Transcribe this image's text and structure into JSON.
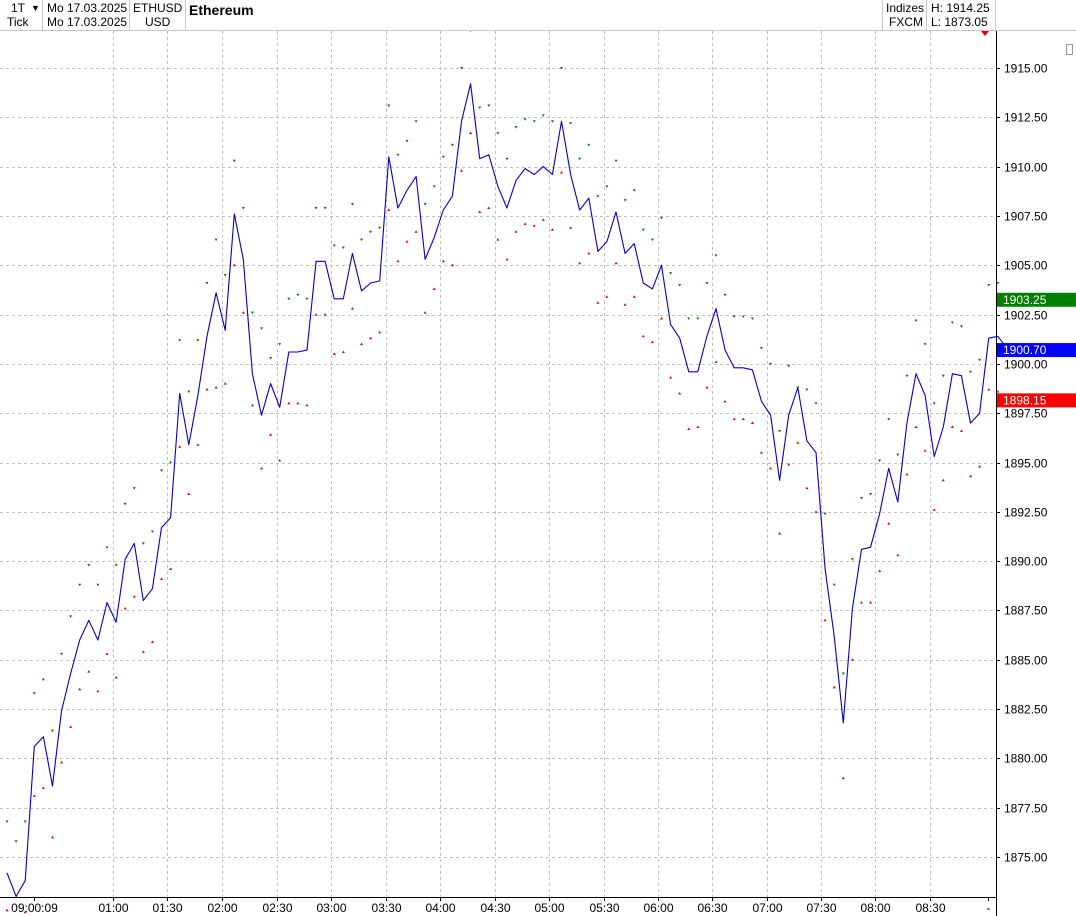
{
  "header": {
    "interval": "1T",
    "interval_sub": "Tick",
    "date_from": "Mo 17.03.2025",
    "date_to": "Mo 17.03.2025",
    "symbol": "ETHUSD",
    "currency": "USD",
    "instrument": "Ethereum",
    "category": "Indizes",
    "source": "FXCM",
    "high": "H: 1914.25",
    "low": "L: 1873.05"
  },
  "colors": {
    "line": "#0000cc",
    "upper_band": "#007a00",
    "lower_band": "#e00000",
    "tag_green": "#008000",
    "tag_blue": "#0000ff",
    "tag_red": "#ff0000",
    "grid": "#c0c0c0"
  },
  "chart_data": {
    "type": "line",
    "title": "Ethereum",
    "x_tick_labels": [
      "09:00:09",
      "01:00",
      "01:30",
      "02:00",
      "02:30",
      "03:00",
      "03:30",
      "04:00",
      "04:30",
      "05:00",
      "05:30",
      "06:00",
      "06:30",
      "07:00",
      "07:30",
      "08:00",
      "08:30",
      "-"
    ],
    "y_ticks": [
      1875.0,
      1877.5,
      1880.0,
      1882.5,
      1885.0,
      1887.5,
      1890.0,
      1892.5,
      1895.0,
      1897.5,
      1900.0,
      1902.5,
      1905.0,
      1907.5,
      1910.0,
      1912.5,
      1915.0
    ],
    "ylim": [
      1872.0,
      1917.8
    ],
    "grid": true,
    "series": [
      {
        "role": "price",
        "values": [
          1874.2,
          1873.0,
          1873.8,
          1880.6,
          1881.1,
          1878.6,
          1882.4,
          1884.3,
          1886.0,
          1887.0,
          1886.0,
          1887.9,
          1886.9,
          1890.1,
          1890.9,
          1888.0,
          1888.6,
          1891.7,
          1892.2,
          1898.5,
          1895.9,
          1898.4,
          1901.4,
          1903.6,
          1901.7,
          1907.6,
          1905.3,
          1899.5,
          1897.4,
          1899.0,
          1897.8,
          1900.6,
          1900.6,
          1900.7,
          1905.2,
          1905.2,
          1903.3,
          1903.3,
          1905.6,
          1903.7,
          1904.1,
          1904.2,
          1910.5,
          1907.9,
          1908.8,
          1909.5,
          1905.3,
          1906.4,
          1907.8,
          1908.5,
          1912.3,
          1914.2,
          1910.4,
          1910.6,
          1909.0,
          1907.9,
          1909.3,
          1909.9,
          1909.6,
          1910.0,
          1909.6,
          1912.3,
          1909.6,
          1907.8,
          1908.4,
          1905.7,
          1906.2,
          1907.7,
          1905.6,
          1906.1,
          1904.1,
          1903.8,
          1905.0,
          1902.0,
          1901.3,
          1899.6,
          1899.6,
          1901.4,
          1902.8,
          1900.7,
          1899.8,
          1899.8,
          1899.7,
          1898.1,
          1897.4,
          1894.1,
          1897.4,
          1898.8,
          1896.1,
          1895.5,
          1889.6,
          1886.2,
          1881.8,
          1887.6,
          1890.6,
          1890.7,
          1892.4,
          1894.7,
          1893.0,
          1897.0,
          1899.5,
          1898.4,
          1895.3,
          1896.8,
          1899.5,
          1899.4,
          1897.0,
          1897.5,
          1901.3,
          1901.4,
          1900.8
        ]
      },
      {
        "role": "upper-band",
        "values": [
          1876.8,
          1875.8,
          1876.8,
          1883.3,
          1884.0,
          1881.4,
          1885.3,
          1887.2,
          1888.8,
          1889.8,
          1888.8,
          1890.7,
          1889.8,
          1892.9,
          1893.7,
          1890.9,
          1891.5,
          1894.6,
          1895.0,
          1901.2,
          1898.6,
          1901.2,
          1904.1,
          1906.3,
          1904.5,
          1910.3,
          1907.9,
          1902.6,
          1901.8,
          1900.3,
          1901.0,
          1903.3,
          1903.5,
          1903.3,
          1907.9,
          1907.9,
          1906.0,
          1905.9,
          1908.1,
          1906.3,
          1906.7,
          1906.9,
          1913.1,
          1910.6,
          1911.3,
          1912.3,
          1908.1,
          1909.0,
          1910.5,
          1911.1,
          1915.0,
          1916.9,
          1913.0,
          1913.1,
          1911.7,
          1910.4,
          1912.0,
          1912.4,
          1912.3,
          1912.6,
          1912.3,
          1915.0,
          1912.2,
          1910.4,
          1911.1,
          1908.5,
          1909.0,
          1910.3,
          1908.3,
          1908.8,
          1906.8,
          1906.3,
          1907.4,
          1904.6,
          1904.0,
          1902.3,
          1902.3,
          1904.1,
          1905.5,
          1903.5,
          1902.4,
          1902.4,
          1902.3,
          1900.8,
          1900.0,
          1896.6,
          1899.9,
          1898.8,
          1898.7,
          1898.0,
          1892.4,
          1888.8,
          1884.3,
          1890.1,
          1893.2,
          1893.4,
          1895.1,
          1897.2,
          1895.4,
          1899.4,
          1902.2,
          1901.0,
          1898.0,
          1899.4,
          1902.1,
          1901.9,
          1899.6,
          1900.2,
          1904.0,
          1904.1,
          1903.4
        ]
      },
      {
        "role": "lower-band",
        "values": [
          1872.3,
          1871.4,
          1872.2,
          1878.1,
          1878.5,
          1876.0,
          1879.8,
          1881.6,
          1883.5,
          1884.4,
          1883.4,
          1885.3,
          1884.1,
          1887.6,
          1888.2,
          1885.4,
          1885.9,
          1889.1,
          1889.6,
          1895.8,
          1893.4,
          1895.9,
          1898.7,
          1898.8,
          1899.0,
          1905.0,
          1902.6,
          1897.9,
          1894.7,
          1896.4,
          1895.1,
          1898.0,
          1898.0,
          1897.9,
          1902.5,
          1902.5,
          1900.5,
          1900.6,
          1902.8,
          1901.0,
          1901.3,
          1901.6,
          1907.8,
          1905.2,
          1906.2,
          1906.7,
          1902.6,
          1903.8,
          1905.2,
          1905.0,
          1909.8,
          1911.7,
          1907.7,
          1907.9,
          1906.3,
          1905.3,
          1906.7,
          1907.1,
          1907.0,
          1907.3,
          1906.8,
          1909.7,
          1906.9,
          1905.1,
          1905.6,
          1903.1,
          1903.4,
          1905.1,
          1903.0,
          1903.4,
          1901.4,
          1901.1,
          1902.3,
          1899.3,
          1898.5,
          1896.7,
          1896.8,
          1898.8,
          1900.1,
          1898.1,
          1897.2,
          1897.2,
          1897.0,
          1895.5,
          1894.7,
          1891.4,
          1894.9,
          1896.0,
          1893.7,
          1892.5,
          1887.0,
          1883.6,
          1879.0,
          1885.0,
          1887.9,
          1887.9,
          1889.5,
          1891.9,
          1890.3,
          1894.4,
          1896.8,
          1895.6,
          1892.6,
          1894.1,
          1896.8,
          1896.6,
          1894.3,
          1894.8,
          1898.7,
          1898.6,
          1898.2
        ]
      }
    ],
    "price_tags": [
      {
        "label": "1903.25",
        "value": 1903.25,
        "color": "#008000"
      },
      {
        "label": "1900.70",
        "value": 1900.7,
        "color": "#0000ff"
      },
      {
        "label": "1898.15",
        "value": 1898.15,
        "color": "#ff0000"
      }
    ]
  }
}
